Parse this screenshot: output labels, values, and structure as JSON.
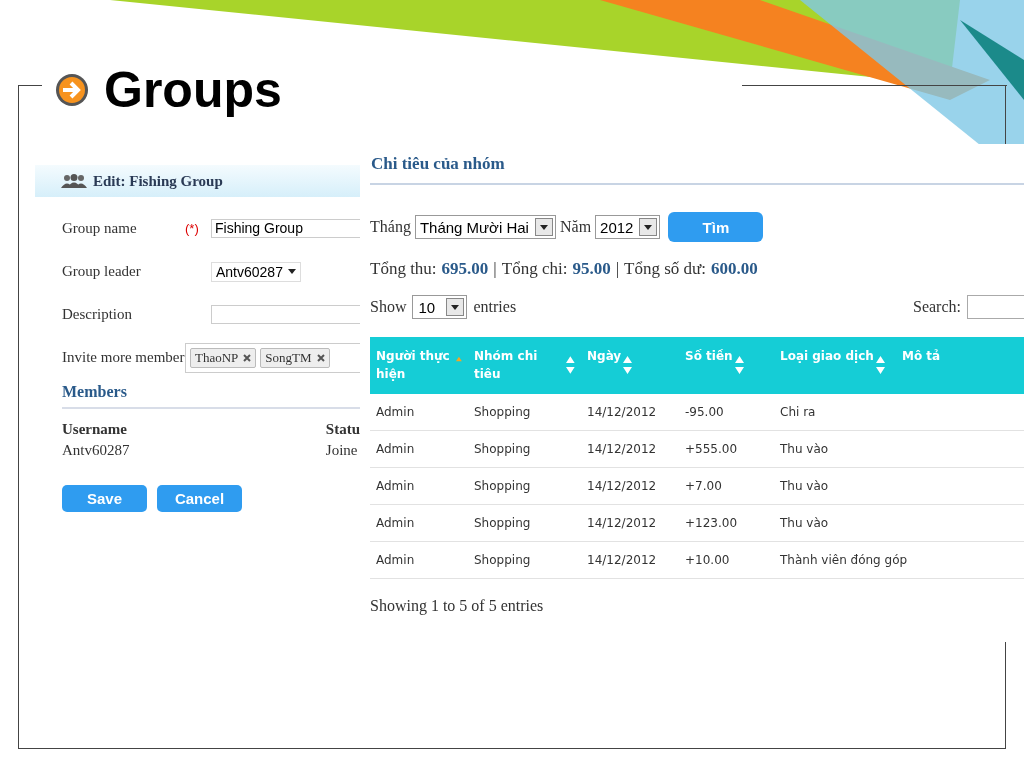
{
  "slide": {
    "title": "Groups"
  },
  "edit_panel": {
    "header": "Edit: Fishing Group",
    "fields": [
      {
        "kind": "text",
        "label": "Group name",
        "required_mark": "(*)",
        "value": "Fishing Group"
      },
      {
        "kind": "select",
        "label": "Group leader",
        "value": "Antv60287"
      },
      {
        "kind": "text",
        "label": "Description"
      },
      {
        "kind": "tags",
        "label": "Invite more member",
        "tags": [
          "ThaoNP",
          "SongTM"
        ]
      }
    ],
    "members_title": "Members",
    "members_columns": [
      "Username",
      "Statu"
    ],
    "members_rows": [
      [
        "Antv60287",
        "Joine"
      ]
    ],
    "buttons": [
      "Save",
      "Cancel"
    ]
  },
  "expense_panel": {
    "title": "Chi tiêu của nhóm",
    "month_label": "Tháng",
    "month_value": "Tháng Mười Hai",
    "year_label": "Năm",
    "year_value": "2012",
    "search_button": "Tìm",
    "totals": [
      {
        "label": "Tổng thu:",
        "value": "695.00"
      },
      {
        "separator": "|",
        "label": "Tổng chi:",
        "value": "95.00"
      },
      {
        "separator": "|",
        "label": "Tổng số dư:",
        "value": "600.00"
      }
    ],
    "show_label": "Show",
    "page_size": "10",
    "entries_label": "entries",
    "search_label": "Search:",
    "columns": [
      {
        "label": "Người thực hiện",
        "sorted": true
      },
      {
        "label": "Nhóm chi tiêu",
        "sortable": true,
        "sorted": false
      },
      {
        "label": "Ngày",
        "sortable": true,
        "sorted": false
      },
      {
        "label": "Số tiền",
        "sortable": true,
        "sorted": false
      },
      {
        "label": "Loại giao dịch",
        "sortable": true,
        "sorted": false
      },
      {
        "label": "Mô tả",
        "sortable": false,
        "sorted": false
      }
    ],
    "rows": [
      [
        "Admin",
        "Shopping",
        "14/12/2012",
        "-95.00",
        "Chi ra"
      ],
      [
        "Admin",
        "Shopping",
        "14/12/2012",
        "+555.00",
        "Thu vào"
      ],
      [
        "Admin",
        "Shopping",
        "14/12/2012",
        "+7.00",
        "Thu vào"
      ],
      [
        "Admin",
        "Shopping",
        "14/12/2012",
        "+123.00",
        "Thu vào"
      ],
      [
        "Admin",
        "Shopping",
        "14/12/2012",
        "+10.00",
        "Thành viên đóng góp"
      ]
    ],
    "footer": "Showing 1 to 5 of 5 entries"
  }
}
